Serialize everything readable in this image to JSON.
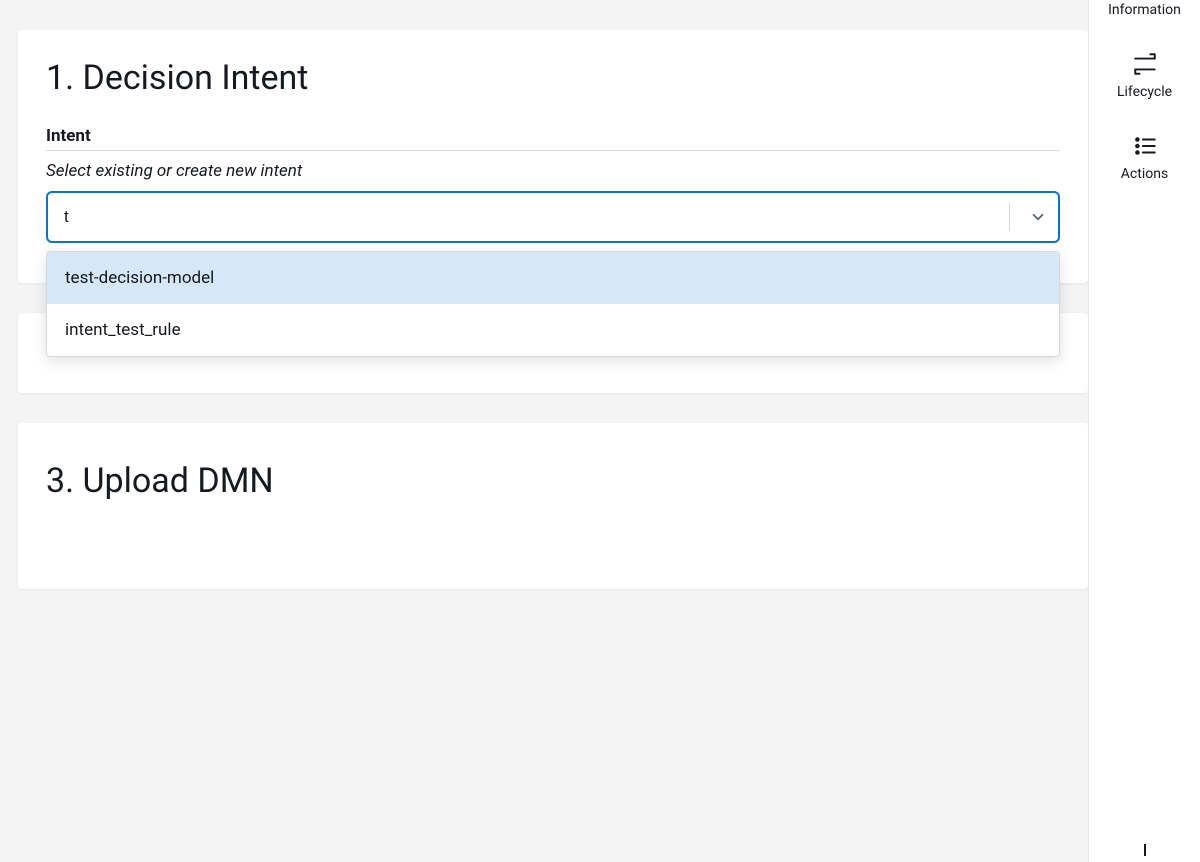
{
  "sections": {
    "decision_intent": {
      "title": "1. Decision Intent",
      "field_label": "Intent",
      "helper": "Select existing or create new intent",
      "input_value": "t",
      "options": [
        "test-decision-model",
        "intent_test_rule"
      ]
    },
    "upload_dmn": {
      "title": "3. Upload DMN"
    }
  },
  "rail": {
    "information": "Information",
    "lifecycle": "Lifecycle",
    "actions": "Actions"
  }
}
